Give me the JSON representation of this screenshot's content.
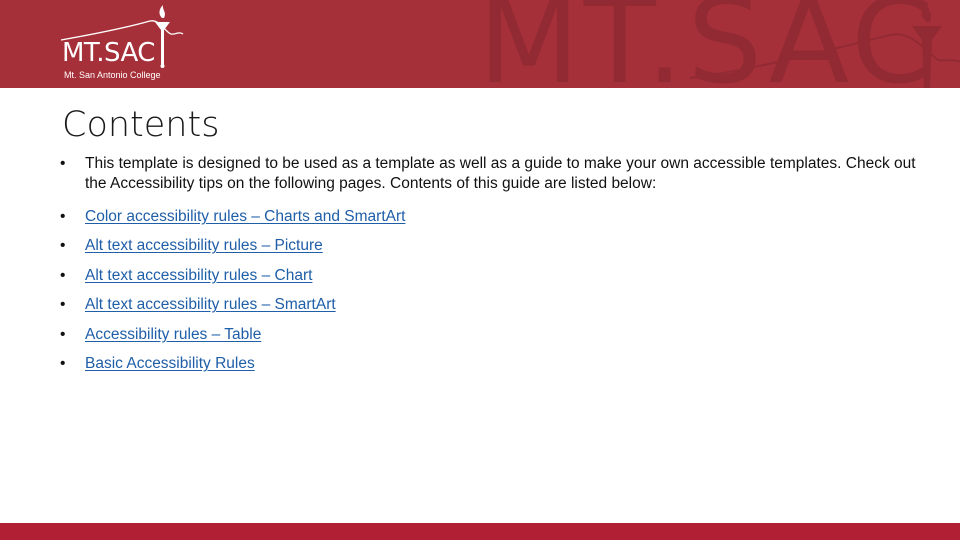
{
  "header": {
    "logo_main": "MT.SAC",
    "logo_sub": "Mt. San Antonio College",
    "watermark": "MT.SAC",
    "color": "#a6303a"
  },
  "slide": {
    "title": "Contents",
    "intro": "This template is designed to be used as a template as well as a guide to make your own accessible templates. Check out the Accessibility tips on the following pages. Contents of this guide are listed below:",
    "bullet_glyph": "•",
    "links": [
      {
        "label": "Color accessibility rules – Charts and SmartArt"
      },
      {
        "label": "Alt text accessibility rules – Picture"
      },
      {
        "label": "Alt text accessibility rules – Chart"
      },
      {
        "label": "Alt text accessibility rules – SmartArt"
      },
      {
        "label": "Accessibility rules – Table"
      },
      {
        "label": "Basic Accessibility Rules"
      }
    ],
    "link_color": "#1f5ea8"
  },
  "footer": {
    "color": "#b01f33"
  }
}
